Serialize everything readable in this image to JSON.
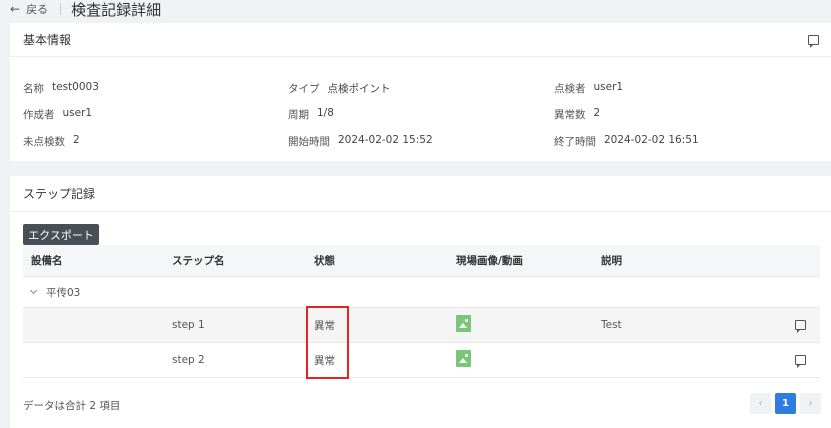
{
  "header": {
    "back_label": "戻る",
    "title": "検査記録詳細"
  },
  "basic_info": {
    "title": "基本情報",
    "rows": [
      [
        {
          "label": "名称",
          "value": "test0003"
        },
        {
          "label": "タイプ",
          "value": "点検ポイント"
        },
        {
          "label": "点検者",
          "value": "user1"
        }
      ],
      [
        {
          "label": "作成者",
          "value": "user1"
        },
        {
          "label": "周期",
          "value": "1/8"
        },
        {
          "label": "異常数",
          "value": "2"
        }
      ],
      [
        {
          "label": "未点検数",
          "value": "2"
        },
        {
          "label": "開始時間",
          "value": "2024-02-02 15:52"
        },
        {
          "label": "終了時間",
          "value": "2024-02-02 16:51"
        }
      ]
    ]
  },
  "steps": {
    "title": "ステップ記録",
    "export_label": "エクスポート",
    "columns": [
      "設備名",
      "ステップ名",
      "状態",
      "現場画像/動画",
      "説明"
    ],
    "group": "平传03",
    "rows": [
      {
        "equipment": "",
        "step": "step 1",
        "status": "異常",
        "media_icon": "image-icon",
        "description": "Test"
      },
      {
        "equipment": "",
        "step": "step 2",
        "status": "異常",
        "media_icon": "image-icon",
        "description": ""
      }
    ],
    "total_text": "データは合計 2 項目",
    "pagination": {
      "prev": "‹",
      "current": "1",
      "next": "›"
    }
  },
  "colors": {
    "accent": "#2f7de1",
    "highlight": "#e32424",
    "export_button": "#4a4f57",
    "media_icon": "#7bc67b"
  }
}
